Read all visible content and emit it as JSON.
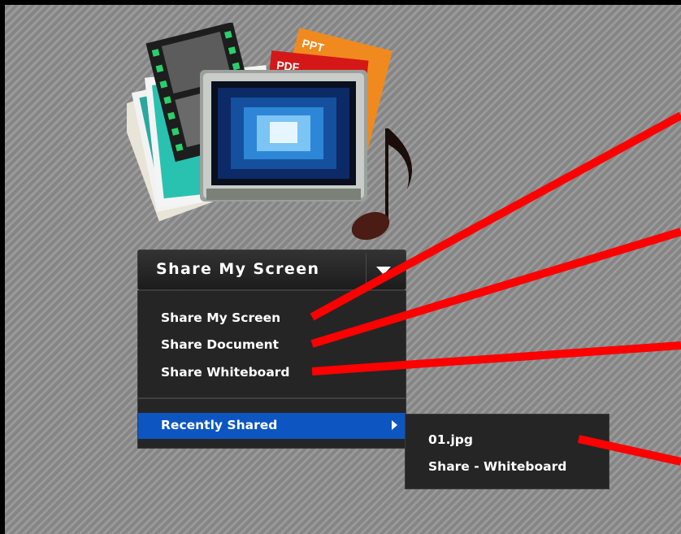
{
  "share_button": {
    "label": "Share My Screen",
    "dropdown_icon": "triangle-down-icon"
  },
  "menu": {
    "items": [
      {
        "label": "Share My Screen"
      },
      {
        "label": "Share Document"
      },
      {
        "label": "Share Whiteboard"
      }
    ],
    "recently_shared": {
      "label": "Recently Shared",
      "arrow_icon": "triangle-right-icon"
    }
  },
  "submenu": {
    "items": [
      {
        "label": "01.jpg"
      },
      {
        "label": "Share - Whiteboard"
      }
    ]
  },
  "artwork": {
    "icon": "share-pod-media-icon",
    "doc_badges": [
      "PPT",
      "PDF"
    ]
  },
  "colors": {
    "background": "#8a8a8a",
    "menu_bg": "#252525",
    "highlight": "#0d56c2",
    "annotation_line": "#ff0000"
  }
}
